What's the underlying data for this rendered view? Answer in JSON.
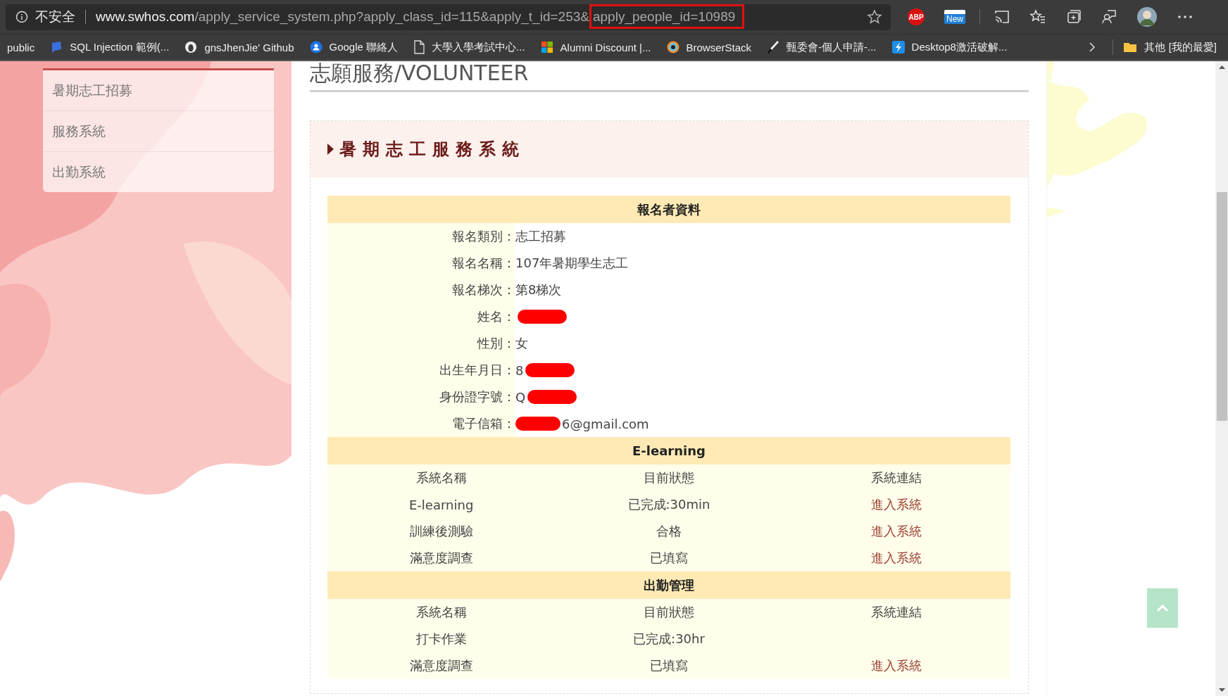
{
  "browser": {
    "security_label": "不安全",
    "url": [
      {
        "text": "www.swhos.com",
        "kind": "domain"
      },
      {
        "text": "/apply_service_system.php?apply_class_id=115&apply_t_id=253&",
        "kind": "path"
      },
      {
        "text": "apply_people_id=10989",
        "kind": "highlighted"
      }
    ],
    "extension_badge": "ABP",
    "new_badge": "New"
  },
  "bookmarks": [
    {
      "label": "public"
    },
    {
      "label": "SQL Injection 範例(..."
    },
    {
      "label": "gnsJhenJie' Github"
    },
    {
      "label": "Google 聯絡人"
    },
    {
      "label": "大學入學考試中心..."
    },
    {
      "label": "Alumni Discount |..."
    },
    {
      "label": "BrowserStack"
    },
    {
      "label": "甄委會-個人申請-..."
    },
    {
      "label": "Desktop8激活破解..."
    }
  ],
  "other_bookmarks": "其他 [我的最愛]",
  "sidebar": {
    "items": [
      "暑期志工招募",
      "服務系統",
      "出勤系統"
    ]
  },
  "page_title": "志願服務/VOLUNTEER",
  "panel_title": "暑期志工服務系統",
  "sections": [
    {
      "kind": "fields",
      "title": "報名者資料",
      "rows": [
        {
          "label": "報名類別：",
          "value": "志工招募",
          "kind": "plain"
        },
        {
          "label": "報名名稱：",
          "value": "107年暑期學生志工",
          "kind": "plain"
        },
        {
          "label": "報名梯次：",
          "value": "第8梯次",
          "kind": "plain"
        },
        {
          "label": "姓名：",
          "kind": "masked_tail"
        },
        {
          "label": "性別：",
          "value": "女",
          "kind": "plain"
        },
        {
          "label": "出生年月日：",
          "value": "8",
          "kind": "masked_tail"
        },
        {
          "label": "身份證字號：",
          "value": "Q",
          "kind": "masked_tail"
        },
        {
          "label": "電子信箱：",
          "value": "6@gmail.com",
          "kind": "masked_head"
        }
      ]
    },
    {
      "kind": "grid",
      "title": "E-learning",
      "columns": [
        "系統名稱",
        "目前狀態",
        "系統連結"
      ],
      "rows": [
        {
          "name": "E-learning",
          "status": "已完成:30min",
          "link": "進入系統"
        },
        {
          "name": "訓練後測驗",
          "status": "合格",
          "link": "進入系統"
        },
        {
          "name": "滿意度調查",
          "status": "已填寫",
          "link": "進入系統"
        }
      ]
    },
    {
      "kind": "grid",
      "title": "出勤管理",
      "columns": [
        "系統名稱",
        "目前狀態",
        "系統連結"
      ],
      "rows": [
        {
          "name": "打卡作業",
          "status": "已完成:30hr"
        },
        {
          "name": "滿意度調查",
          "status": "已填寫",
          "link": "進入系統"
        }
      ]
    }
  ]
}
